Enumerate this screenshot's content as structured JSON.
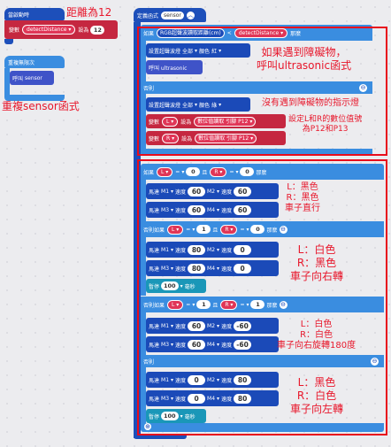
{
  "left": {
    "on_start_label": "當啟動時",
    "set_var": {
      "word": "變數",
      "var": "detectDistance",
      "op": "設為",
      "value": "12"
    },
    "forever_label": "重複無限次",
    "call": {
      "word": "呼叫",
      "name": "sensor"
    }
  },
  "annotations": {
    "distance_note": "距離為12",
    "repeat_note": "重複sensor函式",
    "obstacle_note": "如果遇到障礙物，\n呼叫ultrasonic函式",
    "no_obstacle_note": "沒有遇到障礙物的指示燈",
    "pins_note": "設定L和R的數位值號\n為P12和P13",
    "note1": "L：黑色\nR：黑色\n車子直行",
    "note2": "L：白色\nR：黑色\n車子向右轉",
    "note3": "L：白色\nR：白色\n車子向右旋轉180度",
    "note4": "L：黑色\nR：白色\n車子向左轉"
  },
  "func": {
    "define_label": "定義函式",
    "name": "sensor",
    "if1": {
      "word": "如果",
      "sensor": "RGB超聲波讀取距離(cm)",
      "op": "<",
      "var": "detectDistance",
      "then": "那麼"
    },
    "rgb_set": {
      "label": "設置超聲波燈",
      "all": "全部",
      "color_word": "顏色",
      "color_red": "紅",
      "color_green": "綠"
    },
    "call_ultra": "呼叫 ultrasonic",
    "else_word": "否則",
    "set_L": {
      "word": "變數",
      "var": "L",
      "op": "設為",
      "read": "數位值讀取 引腳",
      "pin": "P12"
    },
    "set_R": {
      "word": "變數",
      "var": "R",
      "op": "設為",
      "read": "數位值讀取 引腳",
      "pin": "P12"
    },
    "if2": {
      "word": "如果",
      "l": "L",
      "eq": "=",
      "and": "且",
      "r": "R",
      "then": "那麼"
    },
    "elseif_word": "否則如果",
    "motor": {
      "word": "馬達",
      "speed": "速度"
    },
    "wait": {
      "word": "暫停",
      "value": "100",
      "unit": "毫秒"
    },
    "cond1": {
      "l": "0",
      "r": "0"
    },
    "cond2": {
      "l": "1",
      "r": "0"
    },
    "cond3": {
      "l": "1",
      "r": "1"
    },
    "m_block1": [
      [
        "M1",
        "60",
        "M2",
        "60"
      ],
      [
        "M3",
        "60",
        "M4",
        "60"
      ]
    ],
    "m_block2": [
      [
        "M1",
        "80",
        "M2",
        "0"
      ],
      [
        "M3",
        "80",
        "M4",
        "0"
      ]
    ],
    "m_block3": [
      [
        "M1",
        "60",
        "M2",
        "-60"
      ],
      [
        "M3",
        "60",
        "M4",
        "-60"
      ]
    ],
    "m_block4": [
      [
        "M1",
        "0",
        "M2",
        "80"
      ],
      [
        "M3",
        "0",
        "M4",
        "80"
      ]
    ]
  }
}
